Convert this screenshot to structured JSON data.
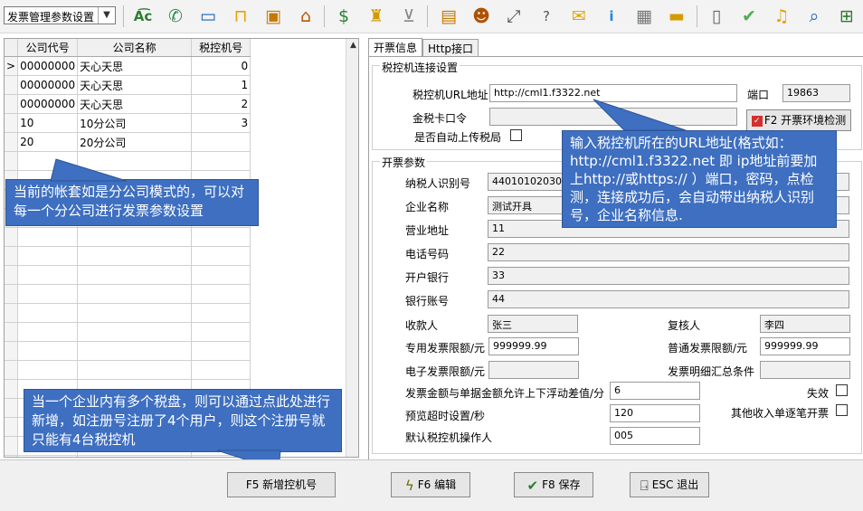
{
  "toolbar": {
    "module_select": "发票管理参数设置",
    "icons": [
      "spell-check-icon",
      "phone-icon",
      "monitor-icon",
      "lock-icon",
      "briefcase-icon",
      "home-icon",
      "dollar-icon",
      "money-bag-icon",
      "cart-icon",
      "clipboard-icon",
      "users-icon",
      "link-icon",
      "help-icon",
      "mail-icon",
      "info-icon",
      "calculator-icon",
      "folder-icon",
      "document-icon",
      "check-circle-icon",
      "bell-icon",
      "search-icon",
      "tree-icon"
    ]
  },
  "grid": {
    "headers": [
      "公司代号",
      "公司名称",
      "税控机号"
    ],
    "rows": [
      {
        "code": "00000000",
        "name": "天心天思",
        "machine": "0"
      },
      {
        "code": "00000000",
        "name": "天心天思",
        "machine": "1"
      },
      {
        "code": "00000000",
        "name": "天心天思",
        "machine": "2"
      },
      {
        "code": "10",
        "name": "10分公司",
        "machine": "3"
      },
      {
        "code": "20",
        "name": "20分公司",
        "machine": ""
      }
    ]
  },
  "callouts": {
    "branch": "当前的帐套如是分公司模式的，可以对每一个分公司进行发票参数设置",
    "add_machine": "当一个企业内有多个税盘，则可以通过点此处进行新增，如注册号注册了4个用户，则这个注册号就只能有4台税控机",
    "url": "输入税控机所在的URL地址(格式如：http://cml1.f3322.net 即 ip地址前要加上http://或https:// ）端口，密码，点检测，连接成功后，会自动带出纳税人识别号，企业名称信息."
  },
  "tabs": [
    "开票信息",
    "Http接口"
  ],
  "connection": {
    "title": "税控机连接设置",
    "url_label": "税控机URL地址",
    "url_value": "http://cml1.f3322.net",
    "port_label": "端口",
    "port_value": "19863",
    "password_label": "金税卡口令",
    "password_value": "",
    "detect_button": "F2 开票环境检测",
    "auto_upload_label": "是否自动上传税局"
  },
  "invoice": {
    "title": "开票参数",
    "taxpayer_id_label": "纳税人识别号",
    "taxpayer_id_value": "440101020304050",
    "company_label": "企业名称",
    "company_value": "测试开具",
    "address_label": "营业地址",
    "address_value": "11",
    "phone_label": "电话号码",
    "phone_value": "22",
    "bank_label": "开户银行",
    "bank_value": "33",
    "account_label": "银行账号",
    "account_value": "44",
    "payee_label": "收款人",
    "payee_value": "张三",
    "reviewer_label": "复核人",
    "reviewer_value": "李四",
    "special_limit_label": "专用发票限额/元",
    "special_limit_value": "999999.99",
    "normal_limit_label": "普通发票限额/元",
    "normal_limit_value": "999999.99",
    "e_limit_label": "电子发票限额/元",
    "e_limit_value": "",
    "detail_summary_label": "发票明细汇总条件",
    "detail_summary_value": "",
    "diff_label": "发票金额与单据金额允许上下浮动差值/分",
    "diff_value": "6",
    "invalid_label": "失效",
    "timeout_label": "预览超时设置/秒",
    "timeout_value": "120",
    "other_income_label": "其他收入单逐笔开票",
    "operator_label": "默认税控机操作人",
    "operator_value": "005"
  },
  "buttons": {
    "add": "F5 新增控机号",
    "edit": "F6 编辑",
    "save": "F8 保存",
    "exit": "ESC 退出"
  }
}
